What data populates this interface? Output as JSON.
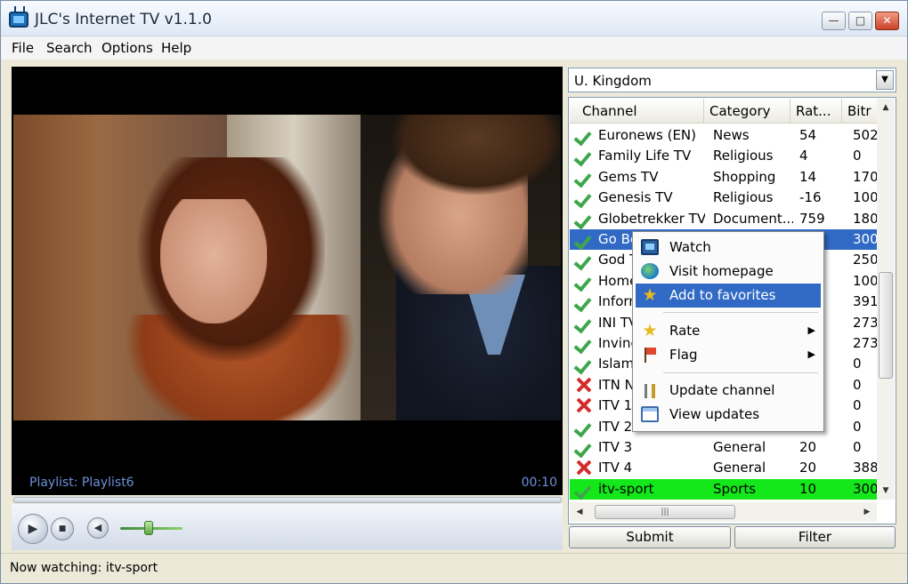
{
  "window": {
    "title": "JLC's Internet TV v1.1.0",
    "controls": [
      "minimize",
      "maximize",
      "close"
    ]
  },
  "menu": [
    "File",
    "Search",
    "Options",
    "Help"
  ],
  "player": {
    "playlist": "Playlist: Playlist6",
    "time": "00:10",
    "volume_level": 0.45
  },
  "country": "U. Kingdom",
  "columns": [
    "Channel",
    "Category",
    "Rat...",
    "Bitr"
  ],
  "rows": [
    {
      "status": "ok",
      "channel": "Euronews (EN)",
      "category": "News",
      "rating": "54",
      "bitrate": "502"
    },
    {
      "status": "ok",
      "channel": "Family Life TV",
      "category": "Religious",
      "rating": "4",
      "bitrate": "0"
    },
    {
      "status": "ok",
      "channel": "Gems TV",
      "category": "Shopping",
      "rating": "14",
      "bitrate": "170"
    },
    {
      "status": "ok",
      "channel": "Genesis TV",
      "category": "Religious",
      "rating": "-16",
      "bitrate": "100"
    },
    {
      "status": "ok",
      "channel": "Globetrekker TV",
      "category": "Document...",
      "rating": "759",
      "bitrate": "180"
    },
    {
      "status": "ok",
      "channel": "Go Be",
      "category": "",
      "rating": "",
      "bitrate": "300"
    },
    {
      "status": "ok",
      "channel": "God T",
      "category": "",
      "rating": "",
      "bitrate": "250"
    },
    {
      "status": "ok",
      "channel": "Home",
      "category": "",
      "rating": "",
      "bitrate": "100"
    },
    {
      "status": "ok",
      "channel": "Inform",
      "category": "",
      "rating": "",
      "bitrate": "391"
    },
    {
      "status": "ok",
      "channel": "INI TV",
      "category": "",
      "rating": "",
      "bitrate": "273"
    },
    {
      "status": "ok",
      "channel": "Invinc",
      "category": "",
      "rating": "",
      "bitrate": "273"
    },
    {
      "status": "ok",
      "channel": "Islam (",
      "category": "",
      "rating": "",
      "bitrate": "0"
    },
    {
      "status": "bad",
      "channel": "ITN N",
      "category": "",
      "rating": "",
      "bitrate": "0"
    },
    {
      "status": "bad",
      "channel": "ITV 1",
      "category": "",
      "rating": "",
      "bitrate": "0"
    },
    {
      "status": "ok",
      "channel": "ITV 2",
      "category": "",
      "rating": "",
      "bitrate": "0"
    },
    {
      "status": "ok",
      "channel": "ITV 3",
      "category": "General",
      "rating": "20",
      "bitrate": "0"
    },
    {
      "status": "bad",
      "channel": "ITV 4",
      "category": "General",
      "rating": "20",
      "bitrate": "388"
    },
    {
      "status": "ok",
      "channel": "itv-sport",
      "category": "Sports",
      "rating": "10",
      "bitrate": "300"
    }
  ],
  "selected_row": 5,
  "highlighted_row": 17,
  "context_menu": {
    "items": [
      {
        "label": "Watch",
        "icon": "tv-icon"
      },
      {
        "label": "Visit homepage",
        "icon": "globe-icon"
      },
      {
        "label": "Add to favorites",
        "icon": "star-icon"
      },
      {
        "label": "Rate",
        "icon": "star-icon"
      },
      {
        "label": "Flag",
        "icon": "flag-icon"
      },
      {
        "label": "Update channel",
        "icon": "tools-icon"
      },
      {
        "label": "View updates",
        "icon": "window-icon"
      }
    ],
    "active": "Add to favorites"
  },
  "buttons": {
    "submit": "Submit",
    "filter": "Filter"
  },
  "status": "Now watching: itv-sport",
  "colors": {
    "selection": "#316ac5",
    "now_playing": "#14e81a",
    "ok": "#3ea64a",
    "bad": "#d52a2a"
  }
}
